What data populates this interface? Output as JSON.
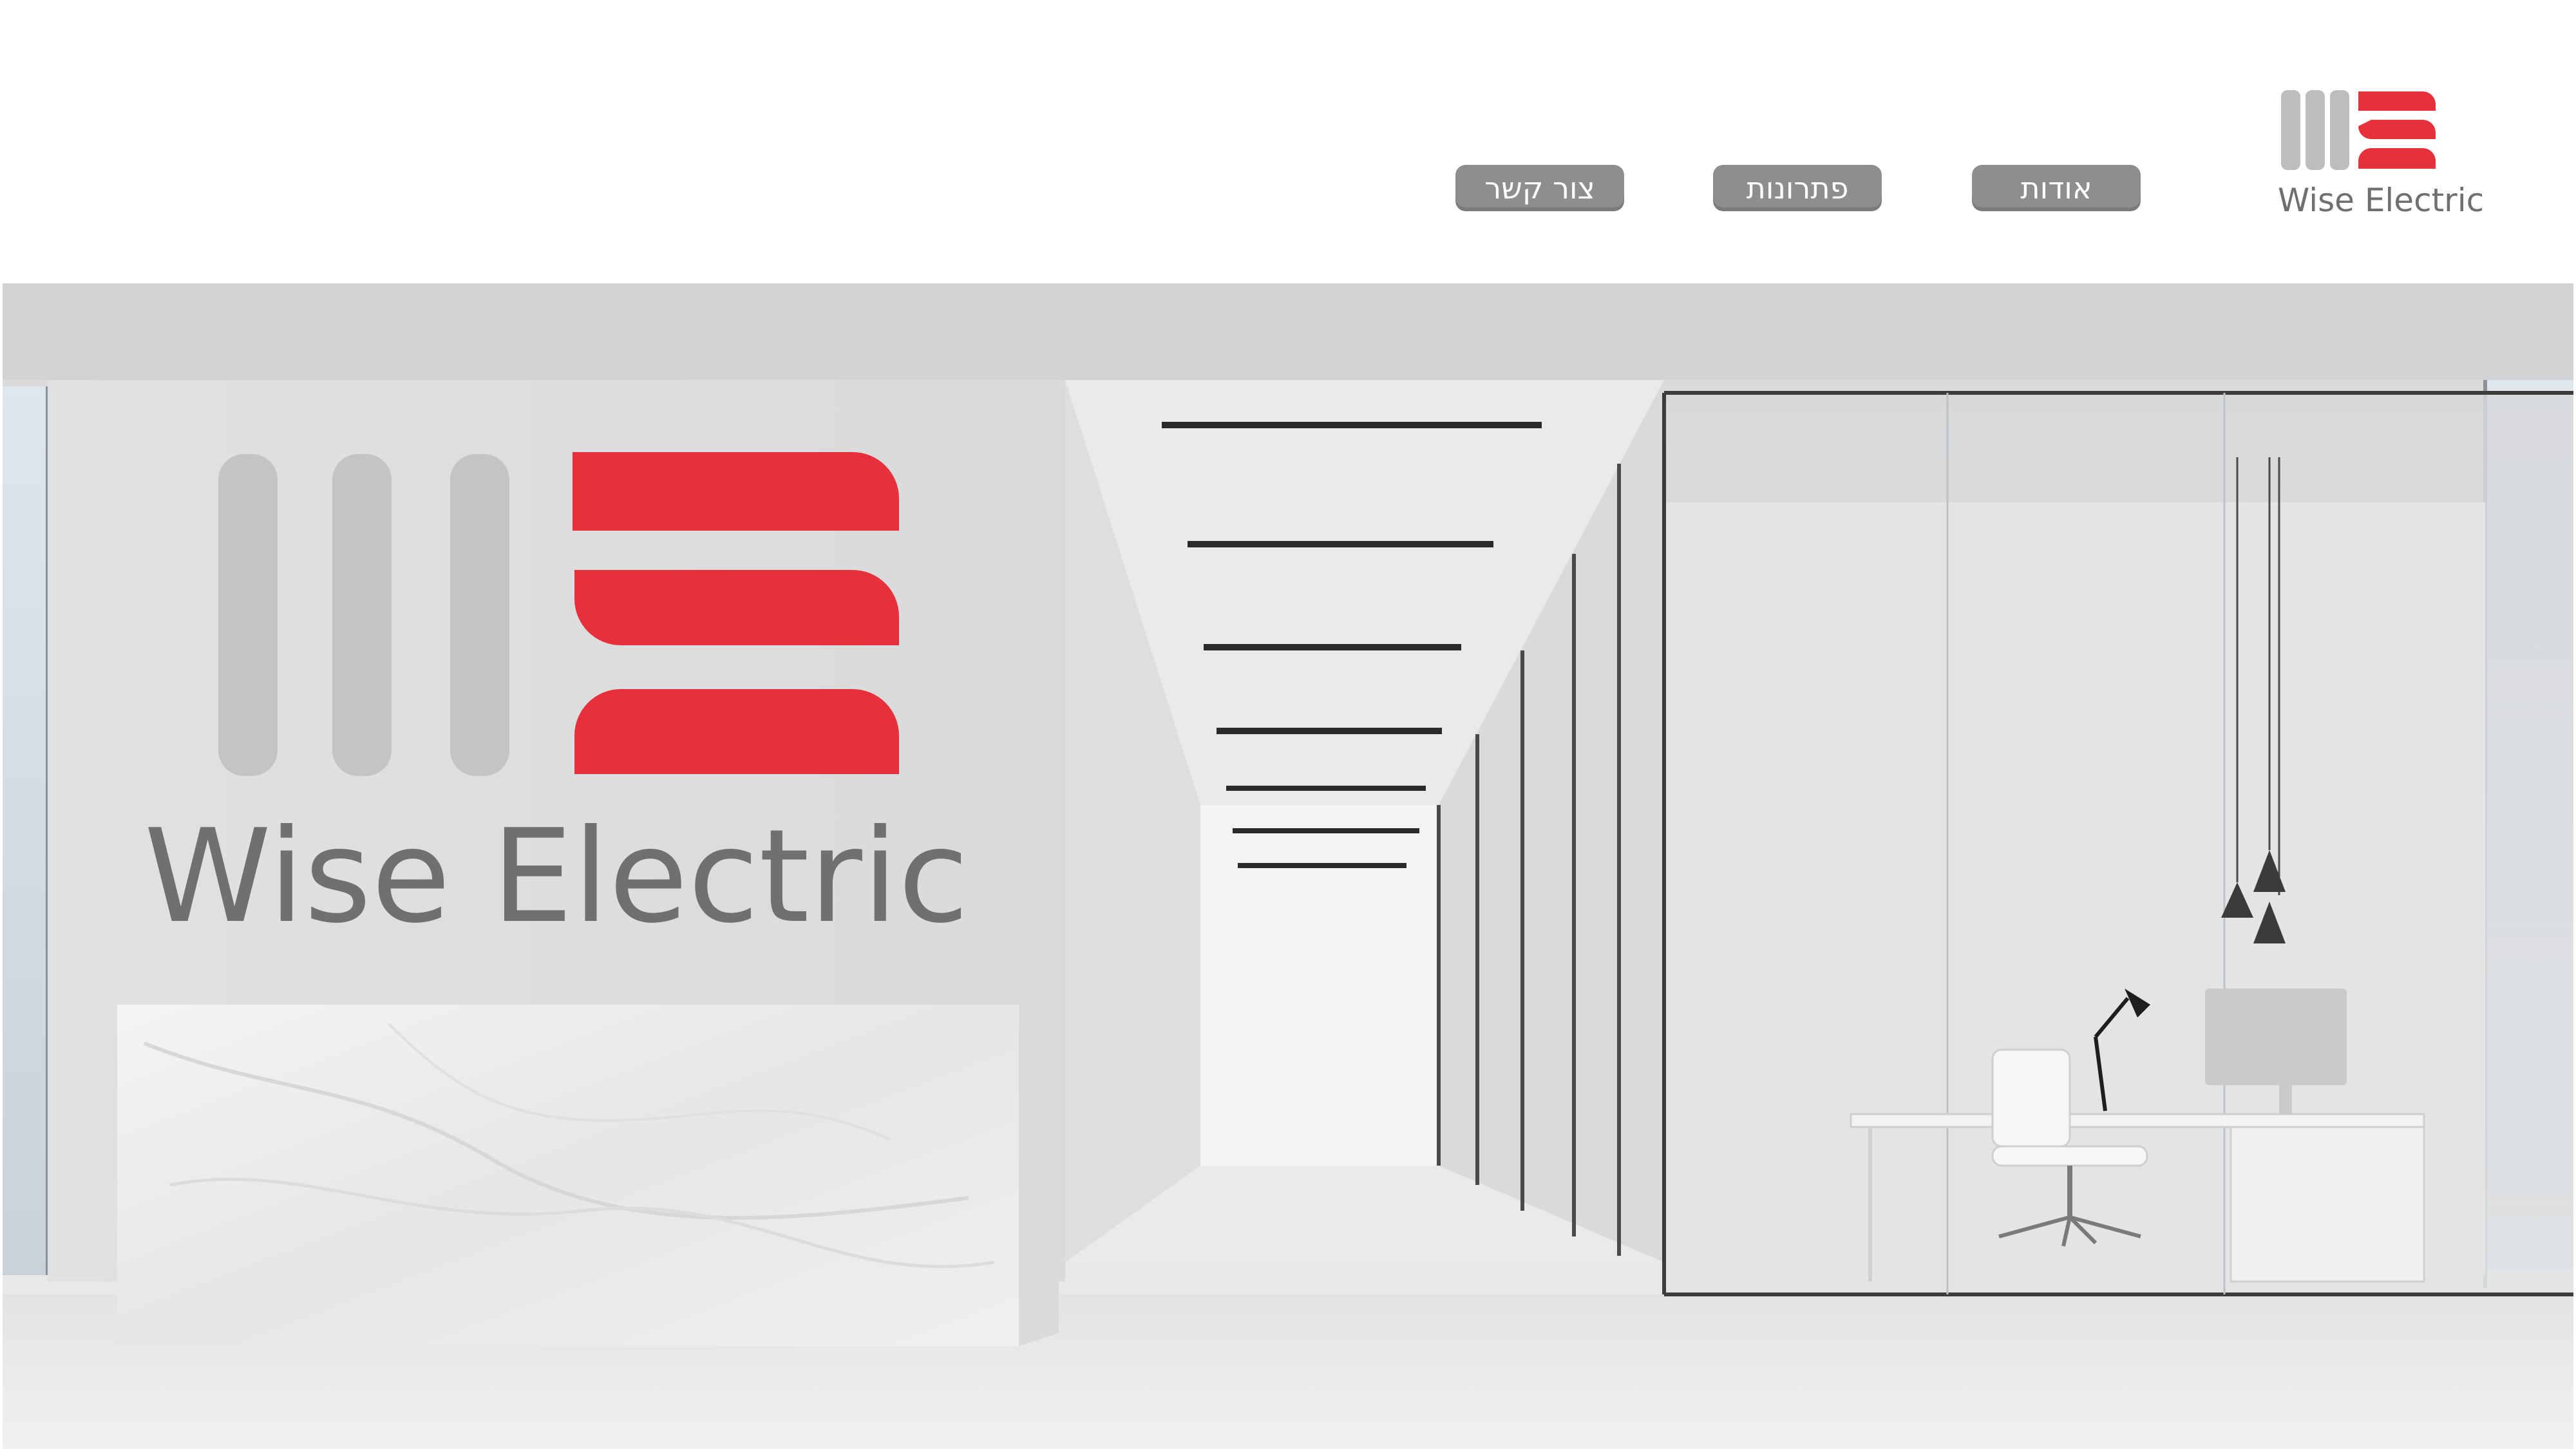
{
  "brand": {
    "name": "Wise Electric",
    "logo_icon": "we-logo-icon",
    "colors": {
      "red": "#e8303a",
      "gray": "#bdbdbd",
      "text_gray": "#6f6f6f",
      "nav_bg": "#8e8e8e"
    }
  },
  "nav": {
    "items": [
      {
        "label": "אודות"
      },
      {
        "label": "פתרונות"
      },
      {
        "label": "צור קשר"
      }
    ]
  },
  "hero": {
    "wall_brand_text": "Wise Electric",
    "image": "office-reception-photo"
  }
}
